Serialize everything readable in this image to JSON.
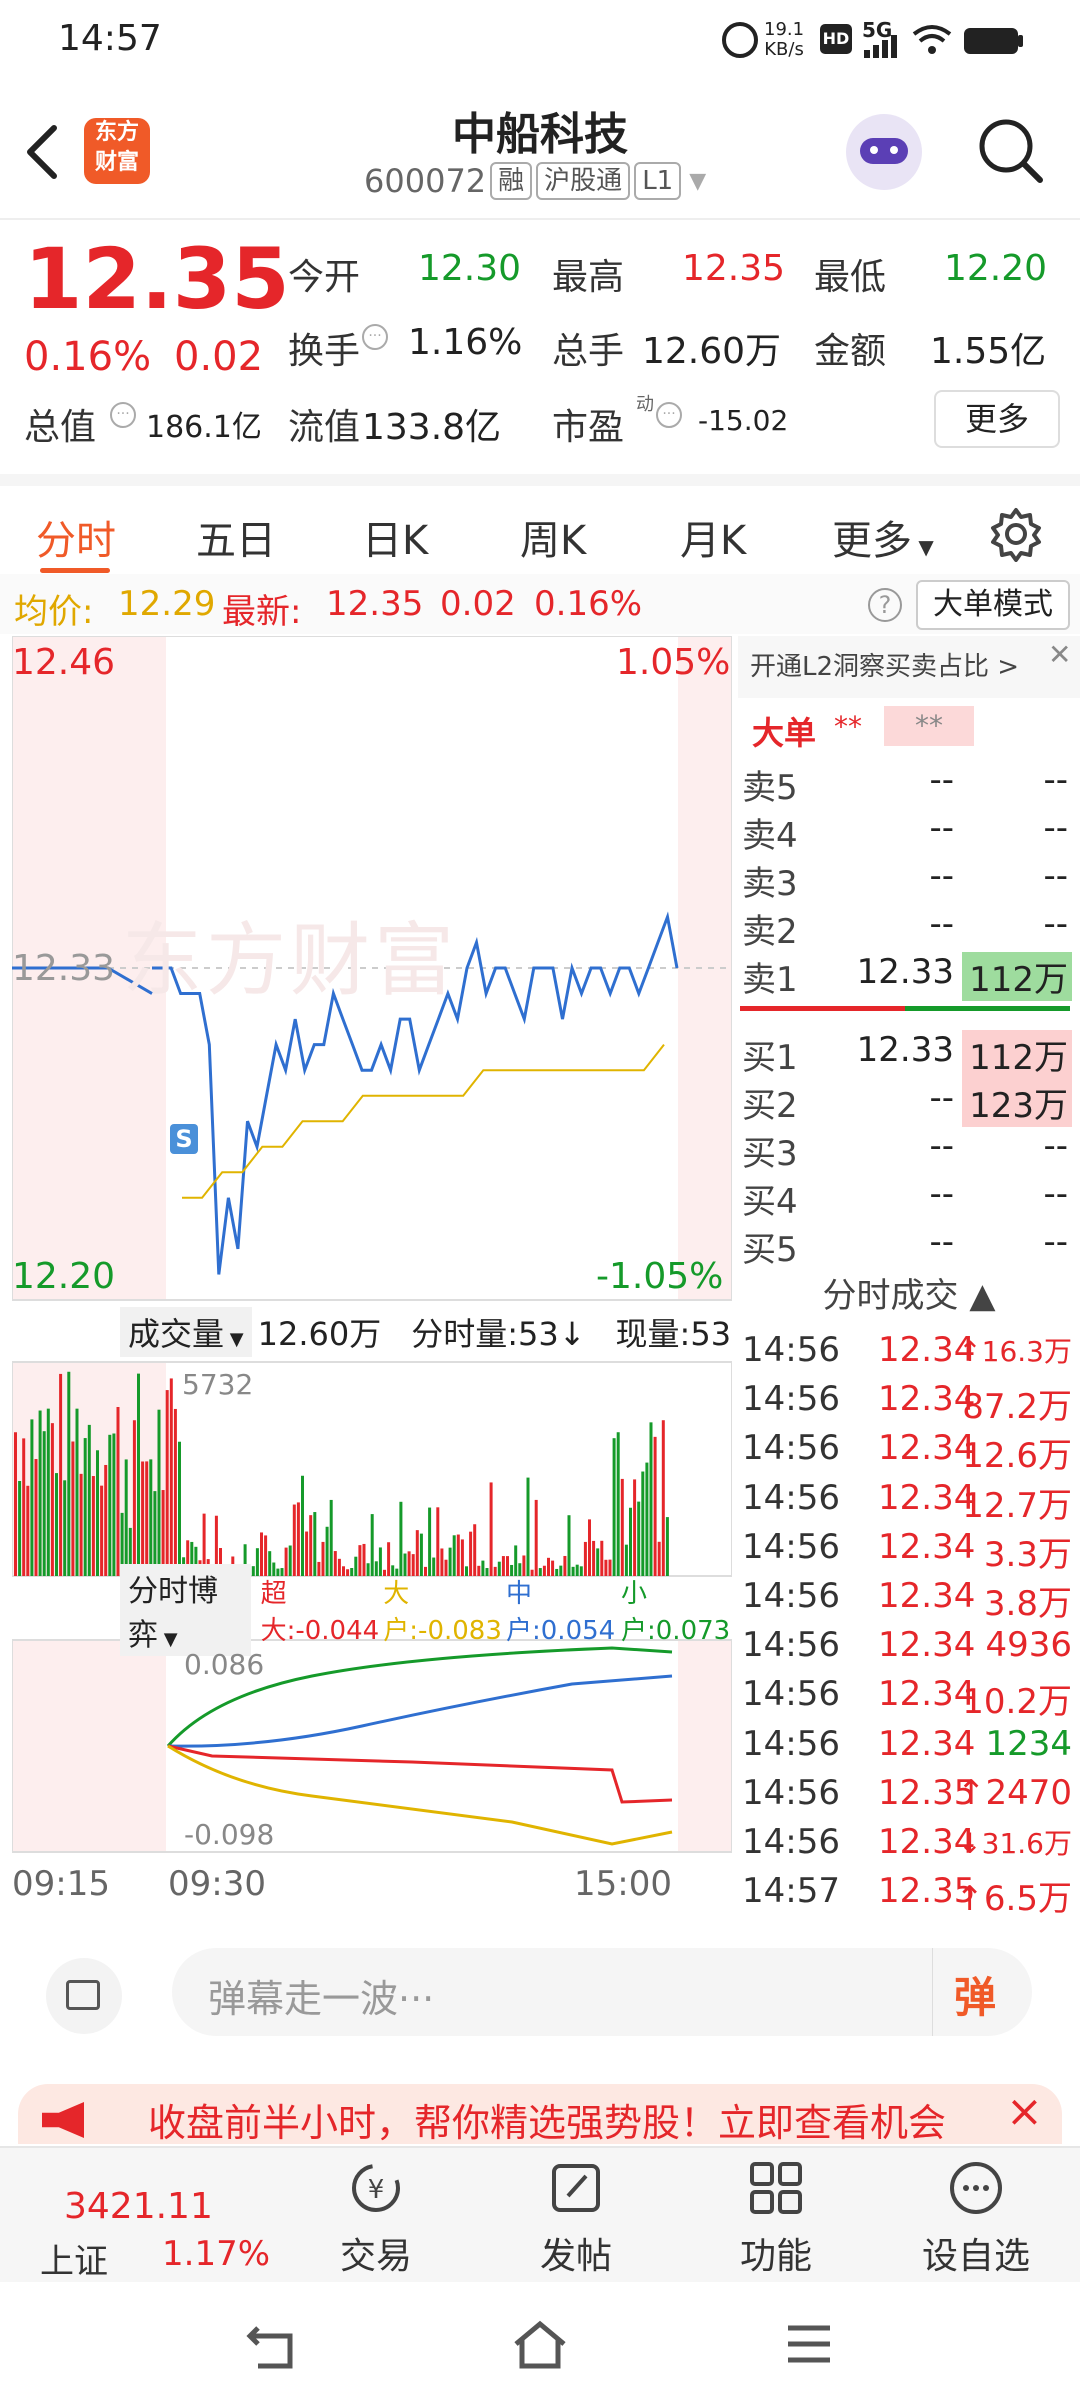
{
  "status": {
    "time": "14:57",
    "net_speed": "19.1",
    "net_unit": "KB/s",
    "hd": "HD",
    "net": "5G"
  },
  "header": {
    "back": "<",
    "logo_line1": "东方",
    "logo_line2": "财富",
    "title": "中船科技",
    "code": "600072",
    "tags": [
      "融",
      "沪股通",
      "L1"
    ]
  },
  "quote": {
    "price": "12.35",
    "change_pct": "0.16%",
    "change": "0.02",
    "items": [
      {
        "label": "今开",
        "value": "12.30",
        "color": "green"
      },
      {
        "label": "最高",
        "value": "12.35",
        "color": "red"
      },
      {
        "label": "最低",
        "value": "12.20",
        "color": "green"
      },
      {
        "label": "换手",
        "value": "1.16%",
        "color": "dark"
      },
      {
        "label": "总手",
        "value": "12.60万",
        "color": "dark"
      },
      {
        "label": "金额",
        "value": "1.55亿",
        "color": "dark"
      },
      {
        "label": "总值",
        "value": "186.1亿",
        "color": "dark"
      },
      {
        "label": "流值",
        "value": "133.8亿",
        "color": "dark"
      },
      {
        "label": "市盈",
        "value": "-15.02",
        "color": "dark"
      }
    ],
    "pe_sup": "动",
    "more": "更多"
  },
  "tabs": [
    "分时",
    "五日",
    "日K",
    "周K",
    "月K",
    "更多"
  ],
  "active_tab": 0,
  "avg_bar": {
    "avg_label": "均价:",
    "avg_value": "12.29",
    "latest_label": "最新:",
    "latest_value": "12.35",
    "chg": "0.02",
    "pct": "0.16%",
    "help": "?",
    "mode_button": "大单模式"
  },
  "chart": {
    "top_price": "12.46",
    "top_pct": "1.05%",
    "mid_price": "12.33",
    "bottom_price": "12.20",
    "bottom_pct": "-1.05%",
    "watermark": "东方财富",
    "s_marker": "S",
    "volume_label": "成交量",
    "volume_total": "12.60万",
    "tick_label": "分时量:53↓",
    "cur_label": "现量:53",
    "vol_axis": "5732",
    "game_label": "分时博弈",
    "game_legend": [
      {
        "name": "超大:-0.044",
        "color": "#e5262a"
      },
      {
        "name": "大户:-0.083",
        "color": "#e0b400"
      },
      {
        "name": "中户:0.054",
        "color": "#2f6fd0"
      },
      {
        "name": "小户:0.073",
        "color": "#159a2a"
      }
    ],
    "game_top": "0.086",
    "game_bottom": "-0.098",
    "times": [
      "09:15",
      "09:30",
      "15:00"
    ]
  },
  "chart_data": {
    "type": "line",
    "title": "",
    "ylim": [
      12.2,
      12.46
    ],
    "prev_close": 12.33,
    "series": [
      {
        "name": "",
        "values": [
          12.33,
          12.33,
          12.33,
          12.32,
          12.32,
          12.32,
          12.3,
          12.21,
          12.24,
          12.22,
          12.27,
          12.26,
          12.28,
          12.3,
          12.29,
          12.31,
          12.29,
          12.3,
          12.3,
          12.32,
          12.31,
          12.3,
          12.29,
          12.29,
          12.3,
          12.29,
          12.31,
          12.31,
          12.29,
          12.3,
          12.31,
          12.32,
          12.31,
          12.33,
          12.34,
          12.32,
          12.33,
          12.33,
          12.32,
          12.31,
          12.33,
          12.33,
          12.33,
          12.31,
          12.33,
          12.32,
          12.33,
          12.33,
          12.32,
          12.33,
          12.33,
          12.32,
          12.33,
          12.34,
          12.35,
          12.33
        ]
      },
      {
        "name": "",
        "values": [
          12.24,
          12.24,
          12.25,
          12.25,
          12.26,
          12.26,
          12.27,
          12.27,
          12.27,
          12.28,
          12.28,
          12.28,
          12.28,
          12.28,
          12.28,
          12.29,
          12.29,
          12.29,
          12.29,
          12.29,
          12.29,
          12.29,
          12.29,
          12.29,
          12.3
        ]
      }
    ]
  },
  "book": {
    "banner": "开通L2洞察买卖占比 >",
    "big_label": "大单",
    "big_v1": "**",
    "big_v2": "**",
    "sell": [
      {
        "n": "卖5",
        "p": "--",
        "v": "--"
      },
      {
        "n": "卖4",
        "p": "--",
        "v": "--"
      },
      {
        "n": "卖3",
        "p": "--",
        "v": "--"
      },
      {
        "n": "卖2",
        "p": "--",
        "v": "--"
      },
      {
        "n": "卖1",
        "p": "12.33",
        "v": "112万"
      }
    ],
    "buy": [
      {
        "n": "买1",
        "p": "12.33",
        "v": "112万"
      },
      {
        "n": "买2",
        "p": "--",
        "v": "123万"
      },
      {
        "n": "买3",
        "p": "--",
        "v": "--"
      },
      {
        "n": "买4",
        "p": "--",
        "v": "--"
      },
      {
        "n": "买5",
        "p": "--",
        "v": "--"
      }
    ],
    "trades_title": "分时成交 ▲",
    "trades": [
      {
        "t": "14:56",
        "p": "12.34",
        "v": "↑16.3万",
        "vc": "red"
      },
      {
        "t": "14:56",
        "p": "12.34",
        "v": "87.2万",
        "vc": "red"
      },
      {
        "t": "14:56",
        "p": "12.34",
        "v": "12.6万",
        "vc": "red"
      },
      {
        "t": "14:56",
        "p": "12.34",
        "v": "12.7万",
        "vc": "red"
      },
      {
        "t": "14:56",
        "p": "12.34",
        "v": "3.3万",
        "vc": "red"
      },
      {
        "t": "14:56",
        "p": "12.34",
        "v": "3.8万",
        "vc": "red"
      },
      {
        "t": "14:56",
        "p": "12.34",
        "v": "4936",
        "vc": "red"
      },
      {
        "t": "14:56",
        "p": "12.34",
        "v": "10.2万",
        "vc": "red"
      },
      {
        "t": "14:56",
        "p": "12.34",
        "v": "1234",
        "vc": "green"
      },
      {
        "t": "14:56",
        "p": "12.35",
        "v": "↑2470",
        "vc": "red"
      },
      {
        "t": "14:56",
        "p": "12.34",
        "v": "↓31.6万",
        "vc": "red"
      },
      {
        "t": "14:57",
        "p": "12.35",
        "v": "↑6.5万",
        "vc": "red"
      }
    ]
  },
  "comment": {
    "placeholder": "弹幕走一波···",
    "dan": "弹"
  },
  "banner": {
    "text": "收盘前半小时，帮你精选强势股！立即查看机会",
    "close": "×"
  },
  "bottom_nav": {
    "index_value": "3421.11",
    "index_name": "上证",
    "index_pct": "1.17%",
    "items": [
      "交易",
      "发帖",
      "功能",
      "设自选"
    ]
  }
}
